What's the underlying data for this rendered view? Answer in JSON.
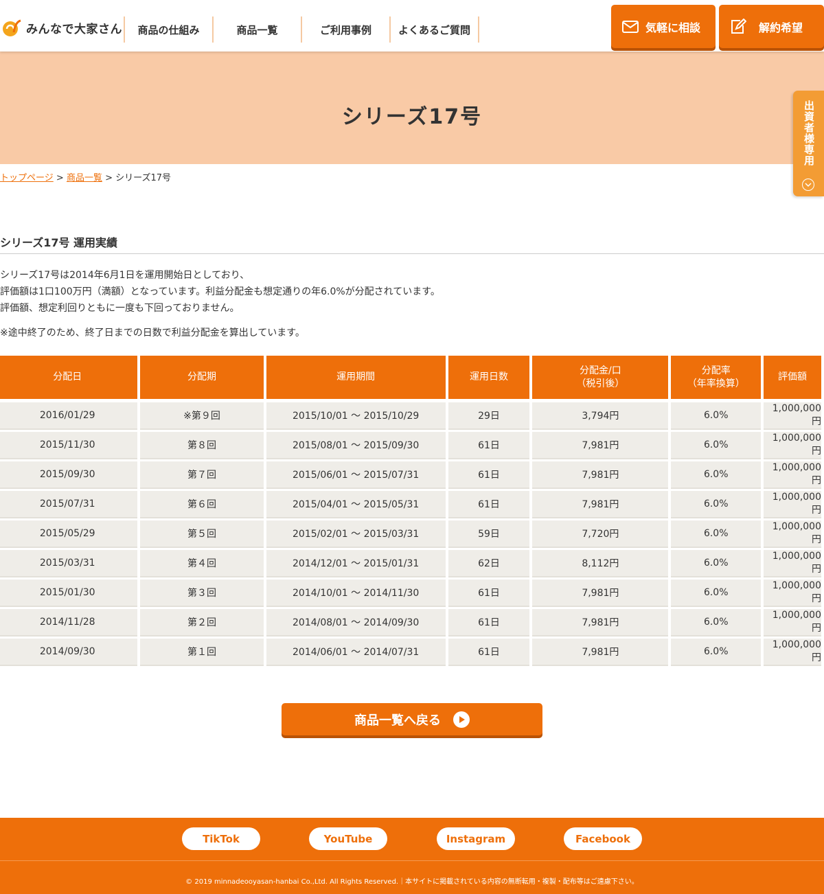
{
  "header": {
    "logo_text": "みんなで大家さん",
    "nav": [
      "商品の仕組み",
      "商品一覧",
      "ご利用事例",
      "よくあるご質問"
    ],
    "consult_button": "気軽に相談",
    "cancel_button": "解約希望"
  },
  "hero": {
    "title": "シリーズ17号"
  },
  "side_tab": {
    "label": "出資者様専用"
  },
  "breadcrumb": {
    "home": "トップページ",
    "list": "商品一覧",
    "current": "シリーズ17号",
    "sep": ">"
  },
  "section": {
    "title": "シリーズ17号 運用実績",
    "description": [
      "シリーズ17号は2014年6月1日を運用開始日としており、",
      "評価額は1口100万円（満額）となっています。利益分配金も想定通りの年6.0%が分配されています。",
      "評価額、想定利回りともに一度も下回っておりません。"
    ],
    "note": "※途中終了のため、終了日までの日数で利益分配金を算出しています。"
  },
  "table": {
    "headers": [
      [
        "分配日"
      ],
      [
        "分配期"
      ],
      [
        "運用期間"
      ],
      [
        "運用日数"
      ],
      [
        "分配金/口",
        "（税引後）"
      ],
      [
        "分配率",
        "（年率換算）"
      ],
      [
        "評価額"
      ]
    ],
    "rows": [
      [
        "2016/01/29",
        "※第９回",
        "2015/10/01 ～ 2015/10/29",
        "29日",
        "3,794円",
        "6.0%",
        "1,000,000円"
      ],
      [
        "2015/11/30",
        "第８回",
        "2015/08/01 ～ 2015/09/30",
        "61日",
        "7,981円",
        "6.0%",
        "1,000,000円"
      ],
      [
        "2015/09/30",
        "第７回",
        "2015/06/01 ～ 2015/07/31",
        "61日",
        "7,981円",
        "6.0%",
        "1,000,000円"
      ],
      [
        "2015/07/31",
        "第６回",
        "2015/04/01 ～ 2015/05/31",
        "61日",
        "7,981円",
        "6.0%",
        "1,000,000円"
      ],
      [
        "2015/05/29",
        "第５回",
        "2015/02/01 ～ 2015/03/31",
        "59日",
        "7,720円",
        "6.0%",
        "1,000,000円"
      ],
      [
        "2015/03/31",
        "第４回",
        "2014/12/01 ～ 2015/01/31",
        "62日",
        "8,112円",
        "6.0%",
        "1,000,000円"
      ],
      [
        "2015/01/30",
        "第３回",
        "2014/10/01 ～ 2014/11/30",
        "61日",
        "7,981円",
        "6.0%",
        "1,000,000円"
      ],
      [
        "2014/11/28",
        "第２回",
        "2014/08/01 ～ 2014/09/30",
        "61日",
        "7,981円",
        "6.0%",
        "1,000,000円"
      ],
      [
        "2014/09/30",
        "第１回",
        "2014/06/01 ～ 2014/07/31",
        "61日",
        "7,981円",
        "6.0%",
        "1,000,000円"
      ]
    ]
  },
  "back_button": "商品一覧へ戻る",
  "footer": {
    "social": [
      "TikTok",
      "YouTube",
      "Instagram",
      "Facebook"
    ],
    "copyright": "© 2019 minnadeooyasan-hanbai Co.,Ltd. All Rights Reserved.｜本サイトに掲載されている内容の無断転用・複製・配布等はご遠慮下さい。"
  },
  "colors": {
    "accent": "#ee6f0a",
    "hero_bg": "#f9caa6",
    "side_tab": "#f39c34",
    "row_bg": "#efede8"
  }
}
